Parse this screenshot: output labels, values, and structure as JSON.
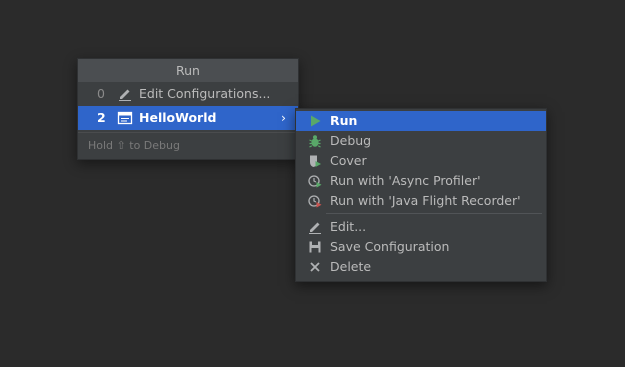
{
  "popup": {
    "title": "Run",
    "items": [
      {
        "number": "0",
        "label": "Edit Configurations...",
        "icon": "pencil-icon"
      },
      {
        "number": "2",
        "label": "HelloWorld",
        "icon": "application-icon",
        "arrow": "›"
      }
    ],
    "hint": "Hold ⇧ to Debug"
  },
  "submenu": {
    "items": [
      {
        "label": "Run",
        "icon": "run-icon"
      },
      {
        "label": "Debug",
        "icon": "debug-icon"
      },
      {
        "label": "Cover",
        "icon": "coverage-icon"
      },
      {
        "label": "Run with 'Async Profiler'",
        "icon": "profiler-icon"
      },
      {
        "label": "Run with 'Java Flight Recorder'",
        "icon": "flight-recorder-icon"
      }
    ],
    "items2": [
      {
        "label": "Edit...",
        "icon": "pencil-icon"
      },
      {
        "label": "Save Configuration",
        "icon": "save-icon"
      },
      {
        "label": "Delete",
        "icon": "delete-icon"
      }
    ]
  },
  "colors": {
    "background": "#2b2b2b",
    "popup": "#3c3f41",
    "selection": "#2f65ca",
    "run_green": "#59a869",
    "text": "#bbbbbb"
  }
}
